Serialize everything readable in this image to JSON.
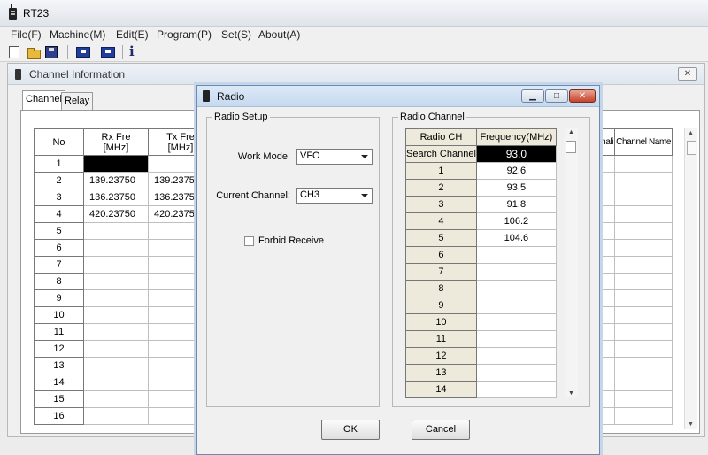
{
  "app": {
    "title": "RT23"
  },
  "menu": [
    "File(F)",
    "Machine(M)",
    "Edit(E)",
    "Program(P)",
    "Set(S)",
    "About(A)"
  ],
  "toolbar": {
    "info_label": "i"
  },
  "channel_window": {
    "title": "Channel Information",
    "close_label": "✕",
    "tabs": [
      "Channel",
      "Relay"
    ],
    "columns": {
      "no": "No",
      "rx": "Rx Fre\n[MHz]",
      "tx": "Tx Fre\n[MHz]",
      "signaling": "gnali",
      "channel_name": "Channel Name"
    },
    "rows": [
      {
        "no": "1",
        "rx": "",
        "tx": ""
      },
      {
        "no": "2",
        "rx": "139.23750",
        "tx": "139.2375"
      },
      {
        "no": "3",
        "rx": "136.23750",
        "tx": "136.2375"
      },
      {
        "no": "4",
        "rx": "420.23750",
        "tx": "420.2375"
      },
      {
        "no": "5",
        "rx": "",
        "tx": ""
      },
      {
        "no": "6",
        "rx": "",
        "tx": ""
      },
      {
        "no": "7",
        "rx": "",
        "tx": ""
      },
      {
        "no": "8",
        "rx": "",
        "tx": ""
      },
      {
        "no": "9",
        "rx": "",
        "tx": ""
      },
      {
        "no": "10",
        "rx": "",
        "tx": ""
      },
      {
        "no": "11",
        "rx": "",
        "tx": ""
      },
      {
        "no": "12",
        "rx": "",
        "tx": ""
      },
      {
        "no": "13",
        "rx": "",
        "tx": ""
      },
      {
        "no": "14",
        "rx": "",
        "tx": ""
      },
      {
        "no": "15",
        "rx": "",
        "tx": ""
      },
      {
        "no": "16",
        "rx": "",
        "tx": ""
      }
    ]
  },
  "dialog": {
    "title": "Radio",
    "min_label": "▁",
    "max_label": "□",
    "close_label": "✕",
    "setup": {
      "group_label": "Radio Setup",
      "work_mode_label": "Work Mode:",
      "work_mode_value": "VFO",
      "current_channel_label": "Current Channel:",
      "current_channel_value": "CH3",
      "forbid_receive_label": "Forbid Receive"
    },
    "channel": {
      "group_label": "Radio Channel",
      "col_ch": "Radio CH",
      "col_freq": "Frequency(MHz)",
      "rows": [
        {
          "ch": "Search Channel",
          "freq": "93.0"
        },
        {
          "ch": "1",
          "freq": "92.6"
        },
        {
          "ch": "2",
          "freq": "93.5"
        },
        {
          "ch": "3",
          "freq": "91.8"
        },
        {
          "ch": "4",
          "freq": "106.2"
        },
        {
          "ch": "5",
          "freq": "104.6"
        },
        {
          "ch": "6",
          "freq": ""
        },
        {
          "ch": "7",
          "freq": ""
        },
        {
          "ch": "8",
          "freq": ""
        },
        {
          "ch": "9",
          "freq": ""
        },
        {
          "ch": "10",
          "freq": ""
        },
        {
          "ch": "11",
          "freq": ""
        },
        {
          "ch": "12",
          "freq": ""
        },
        {
          "ch": "13",
          "freq": ""
        },
        {
          "ch": "14",
          "freq": ""
        }
      ]
    },
    "ok_label": "OK",
    "cancel_label": "Cancel"
  }
}
